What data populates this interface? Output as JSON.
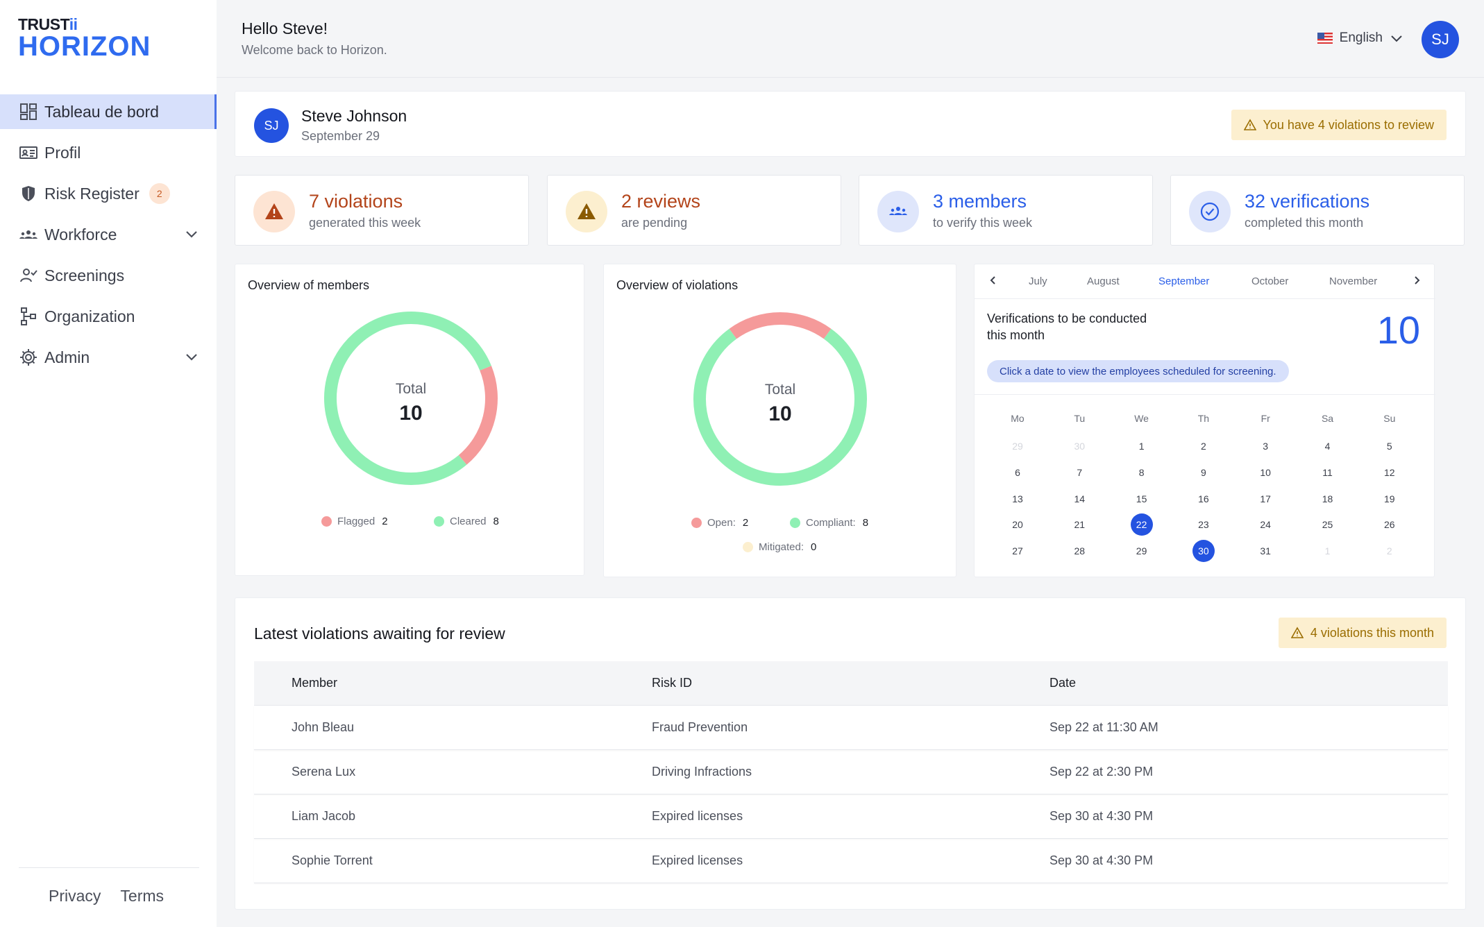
{
  "brand": {
    "top": "TRUST",
    "top_accent": "ii",
    "main": "HORIZON"
  },
  "sidebar": {
    "items": [
      {
        "label": "Tableau de bord",
        "icon": "dashboard-icon"
      },
      {
        "label": "Profil",
        "icon": "id-card-icon"
      },
      {
        "label": "Risk Register",
        "icon": "shield-icon",
        "badge": "2"
      },
      {
        "label": "Workforce",
        "icon": "people-icon"
      },
      {
        "label": "Screenings",
        "icon": "user-check-icon"
      },
      {
        "label": "Organization",
        "icon": "org-chart-icon"
      },
      {
        "label": "Admin",
        "icon": "gear-icon"
      }
    ],
    "footer": {
      "privacy": "Privacy",
      "terms": "Terms"
    }
  },
  "header": {
    "greeting": "Hello Steve!",
    "subtitle": "Welcome back to Horizon.",
    "language": "English",
    "avatar_initials": "SJ"
  },
  "user_card": {
    "initials": "SJ",
    "name": "Steve Johnson",
    "date": "September 29",
    "alert": "You have 4 violations to review"
  },
  "stats": [
    {
      "value": "7 violations",
      "caption": "generated this week",
      "color": "#b3441a",
      "icon_bg": "#fde4d3"
    },
    {
      "value": "2 reviews",
      "caption": "are pending",
      "color": "#b3441a",
      "icon_bg": "#fcefcf"
    },
    {
      "value": "3 members",
      "caption": "to verify this week",
      "color": "#2a5ee8",
      "icon_bg": "#dfe6fb"
    },
    {
      "value": "32 verifications",
      "caption": "completed this month",
      "color": "#2a5ee8",
      "icon_bg": "#dfe6fb"
    }
  ],
  "members_chart": {
    "title": "Overview of members",
    "total_label": "Total",
    "total": "10",
    "legend": [
      {
        "name": "Flagged",
        "value": "2",
        "color": "#f59a9a"
      },
      {
        "name": "Cleared",
        "value": "8",
        "color": "#8ff0b4"
      }
    ]
  },
  "violations_chart": {
    "title": "Overview of violations",
    "total_label": "Total",
    "total": "10",
    "legend": [
      {
        "name": "Open:",
        "value": "2",
        "color": "#f59a9a"
      },
      {
        "name": "Compliant:",
        "value": "8",
        "color": "#8ff0b4"
      },
      {
        "name": "Mitigated:",
        "value": "0",
        "color": "#fcefcf"
      }
    ]
  },
  "calendar": {
    "months": [
      "July",
      "August",
      "September",
      "October",
      "November"
    ],
    "active_month": "September",
    "subtitle": "Verifications to be conducted this month",
    "count": "10",
    "hint": "Click a date to view the employees scheduled for screening.",
    "weekdays": [
      "Mo",
      "Tu",
      "We",
      "Th",
      "Fr",
      "Sa",
      "Su"
    ],
    "weeks": [
      [
        "29",
        "30",
        "1",
        "2",
        "3",
        "4",
        "5"
      ],
      [
        "6",
        "7",
        "8",
        "9",
        "10",
        "11",
        "12"
      ],
      [
        "13",
        "14",
        "15",
        "16",
        "17",
        "18",
        "19"
      ],
      [
        "20",
        "21",
        "22",
        "23",
        "24",
        "25",
        "26"
      ],
      [
        "27",
        "28",
        "29",
        "30",
        "31",
        "1",
        "2"
      ]
    ],
    "selected": [
      "22",
      "30"
    ]
  },
  "violations_table": {
    "title": "Latest violations awaiting for review",
    "badge": "4 violations this month",
    "columns": [
      "Member",
      "Risk ID",
      "Date"
    ],
    "rows": [
      [
        "John Bleau",
        "Fraud Prevention",
        "Sep 22 at 11:30 AM"
      ],
      [
        "Serena Lux",
        "Driving Infractions",
        "Sep 22 at 2:30 PM"
      ],
      [
        "Liam Jacob",
        "Expired licenses",
        "Sep 30 at 4:30 PM"
      ],
      [
        "Sophie Torrent",
        "Expired licenses",
        "Sep 30 at 4:30 PM"
      ]
    ]
  }
}
